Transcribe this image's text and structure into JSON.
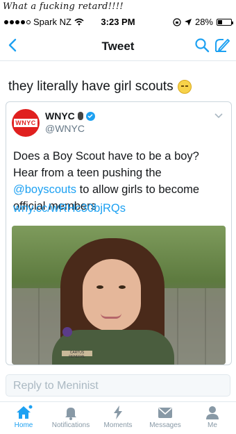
{
  "caption": "What a fucking retard!!!!",
  "status": {
    "carrier": "Spark NZ",
    "time": "3:23 PM",
    "battery": "28%",
    "battery_level": 0.28
  },
  "nav": {
    "title": "Tweet"
  },
  "tweet": {
    "text": "they literally have girl scouts"
  },
  "quoted": {
    "name": "WNYC",
    "handle": "@WNYC",
    "avatar_text": "WNYC",
    "body_part1": "Does a Boy Scout have to be a boy? Hear from a teen pushing the ",
    "mention": "@boyscouts",
    "body_part2": " to allow girls to become official members",
    "link": "wny.cc/wRHc30bjRQs",
    "badge_text": "CARTUS RENERAL"
  },
  "reply": {
    "placeholder": "Reply to Meninist"
  },
  "tabs": [
    {
      "label": "Home",
      "icon": "home-icon"
    },
    {
      "label": "Notifications",
      "icon": "bell-icon"
    },
    {
      "label": "Moments",
      "icon": "lightning-icon"
    },
    {
      "label": "Messages",
      "icon": "envelope-icon"
    },
    {
      "label": "Me",
      "icon": "person-icon"
    }
  ],
  "colors": {
    "accent": "#1da1f2",
    "wnyc_red": "#e0201f",
    "muted": "#8899a6"
  }
}
